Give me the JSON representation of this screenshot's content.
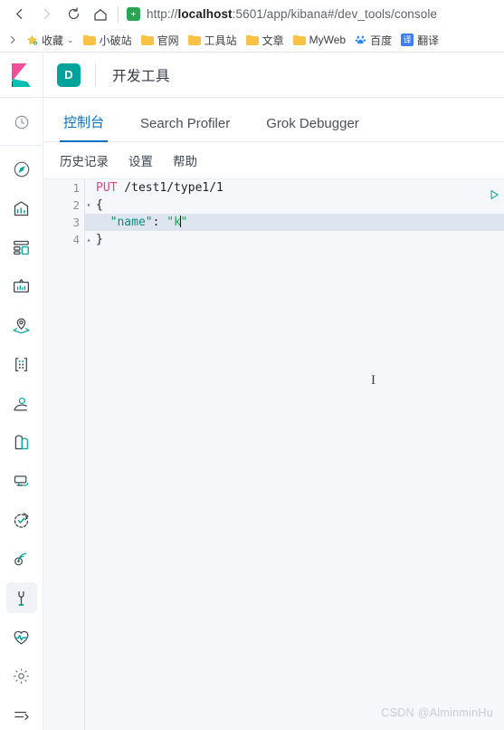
{
  "browser": {
    "nav": {
      "back_label": "Back",
      "forward_label": "Forward",
      "reload_label": "Reload",
      "home_label": "Home"
    },
    "address": {
      "scheme": "http://",
      "host": "localhost",
      "rest": ":5601/app/kibana#/dev_tools/console",
      "full": "http://localhost:5601/app/kibana#/dev_tools/console",
      "security_icon": "shield-icon"
    },
    "bookmarks": {
      "overflow_icon": "chevron-right-icon",
      "items": [
        {
          "label": "收藏",
          "icon": "star-icon",
          "has_caret": true
        },
        {
          "label": "小破站",
          "icon": "folder-icon",
          "has_caret": false
        },
        {
          "label": "官网",
          "icon": "folder-icon",
          "has_caret": false
        },
        {
          "label": "工具站",
          "icon": "folder-icon",
          "has_caret": false
        },
        {
          "label": "文章",
          "icon": "folder-icon",
          "has_caret": false
        },
        {
          "label": "MyWeb",
          "icon": "folder-icon",
          "has_caret": false
        },
        {
          "label": "百度",
          "icon": "baidu-icon",
          "has_caret": false
        },
        {
          "label": "翻译",
          "icon": "translate-icon",
          "has_caret": false
        }
      ]
    }
  },
  "kibana": {
    "logo_name": "kibana-logo",
    "app_badge": "D",
    "app_title": "开发工具",
    "sidebar": [
      {
        "name": "recently-viewed",
        "icon": "clock-icon",
        "active": false,
        "divider_after": true
      },
      {
        "name": "discover",
        "icon": "compass-icon",
        "active": false
      },
      {
        "name": "visualize",
        "icon": "bar-chart-icon",
        "active": false
      },
      {
        "name": "dashboard",
        "icon": "dashboard-icon",
        "active": false
      },
      {
        "name": "canvas",
        "icon": "canvas-icon",
        "active": false
      },
      {
        "name": "maps",
        "icon": "map-pin-icon",
        "active": false
      },
      {
        "name": "machine-learning",
        "icon": "ml-nodes-icon",
        "active": false
      },
      {
        "name": "infrastructure",
        "icon": "user-profile-icon",
        "active": false
      },
      {
        "name": "logs",
        "icon": "logs-icon",
        "active": false
      },
      {
        "name": "apm",
        "icon": "apm-icon",
        "active": false
      },
      {
        "name": "uptime",
        "icon": "uptime-icon",
        "active": false
      },
      {
        "name": "siem",
        "icon": "siem-icon",
        "active": false
      },
      {
        "name": "dev-tools",
        "icon": "wrench-icon",
        "active": true
      },
      {
        "name": "monitoring",
        "icon": "heart-pulse-icon",
        "active": false
      },
      {
        "name": "management",
        "icon": "gear-icon",
        "active": false
      },
      {
        "name": "collapse-nav",
        "icon": "collapse-arrow-icon",
        "active": false
      }
    ],
    "tabs": [
      {
        "label": "控制台",
        "active": true
      },
      {
        "label": "Search Profiler",
        "active": false
      },
      {
        "label": "Grok Debugger",
        "active": false
      }
    ],
    "subbar": [
      {
        "label": "历史记录"
      },
      {
        "label": "设置"
      },
      {
        "label": "帮助"
      }
    ],
    "console": {
      "send_button_icon": "play-icon",
      "cursor_icon": "text-cursor-icon",
      "lines": [
        {
          "number": "1",
          "fold": "",
          "current": false,
          "tokens": [
            {
              "text": "PUT",
              "type": "method"
            },
            {
              "text": " /test1/type1/1",
              "type": "url"
            }
          ]
        },
        {
          "number": "2",
          "fold": "▾",
          "current": false,
          "tokens": [
            {
              "text": "{",
              "type": "brace"
            }
          ]
        },
        {
          "number": "3",
          "fold": "",
          "current": true,
          "tokens": [
            {
              "text": "  ",
              "type": "plain"
            },
            {
              "text": "\"name\"",
              "type": "key"
            },
            {
              "text": ": ",
              "type": "plain"
            },
            {
              "text": "\"k",
              "type": "str"
            },
            {
              "text": "|CARET|",
              "type": "caret"
            },
            {
              "text": "\"",
              "type": "str"
            }
          ]
        },
        {
          "number": "4",
          "fold": "▴",
          "current": false,
          "tokens": [
            {
              "text": "}",
              "type": "brace"
            }
          ]
        }
      ]
    }
  },
  "watermark": "CSDN @AlminminHu"
}
